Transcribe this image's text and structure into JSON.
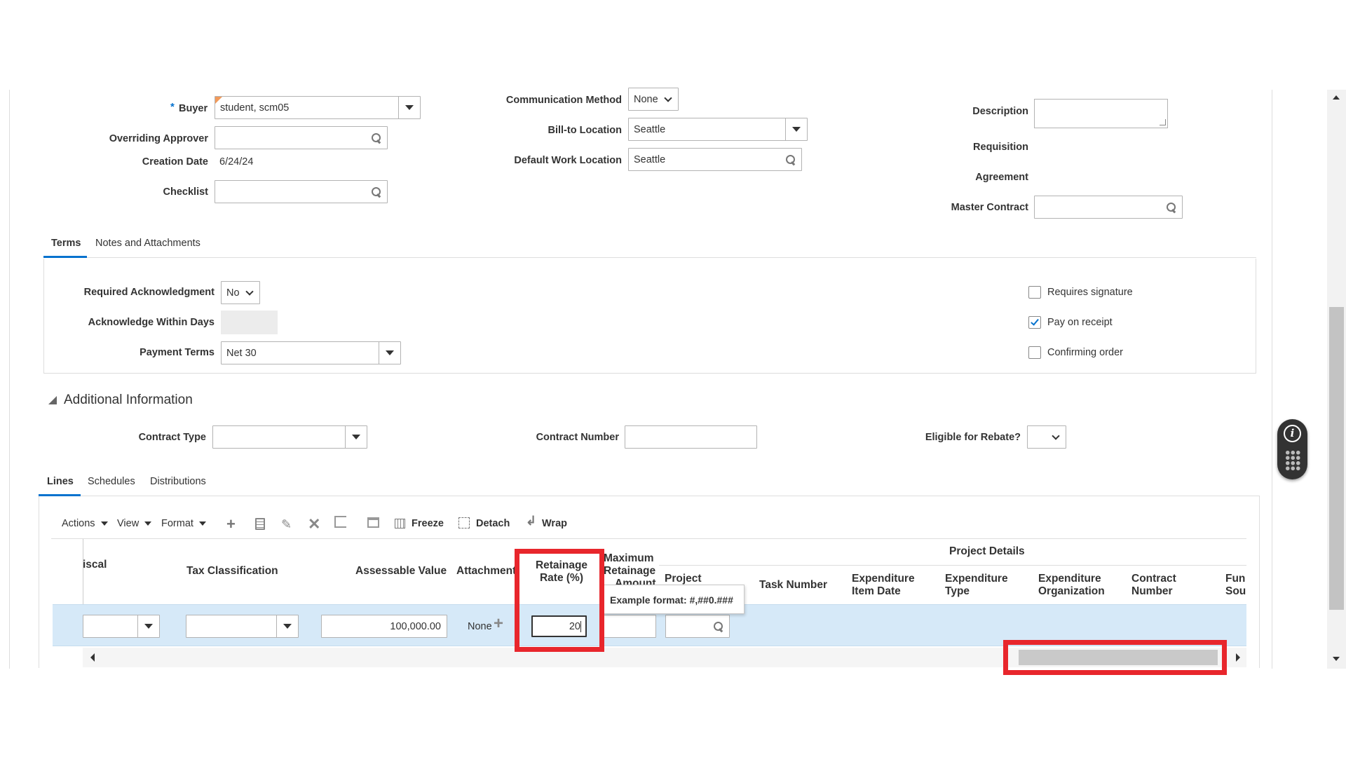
{
  "header": {
    "buyer_label": "Buyer",
    "buyer_value": "student, scm05",
    "overriding_approver_label": "Overriding Approver",
    "creation_date_label": "Creation Date",
    "creation_date_value": "6/24/24",
    "checklist_label": "Checklist",
    "communication_method_label": "Communication Method",
    "communication_method_value": "None",
    "bill_to_label": "Bill-to Location",
    "bill_to_value": "Seattle",
    "default_work_label": "Default Work Location",
    "default_work_value": "Seattle",
    "description_label": "Description",
    "requisition_label": "Requisition",
    "agreement_label": "Agreement",
    "master_contract_label": "Master Contract"
  },
  "terms_tabs": [
    "Terms",
    "Notes and Attachments"
  ],
  "terms": {
    "req_ack_label": "Required Acknowledgment",
    "req_ack_value": "No",
    "ack_days_label": "Acknowledge Within Days",
    "payment_terms_label": "Payment Terms",
    "payment_terms_value": "Net 30",
    "requires_signature": "Requires signature",
    "pay_on_receipt": "Pay on receipt",
    "confirming_order": "Confirming order"
  },
  "additional": {
    "title": "Additional Information",
    "contract_type_label": "Contract Type",
    "contract_number_label": "Contract Number",
    "rebate_label": "Eligible for Rebate?"
  },
  "lines_tabs": [
    "Lines",
    "Schedules",
    "Distributions"
  ],
  "toolbar": {
    "actions": "Actions",
    "view": "View",
    "format": "Format",
    "freeze": "Freeze",
    "detach": "Detach",
    "wrap": "Wrap"
  },
  "table": {
    "group_header": "Project Details",
    "col_fiscal": "iscal",
    "col_tax": "Tax Classification",
    "col_assessable": "Assessable Value",
    "col_attachments": "Attachment",
    "col_retainage_1": "Retainage",
    "col_retainage_2": "Rate (%)",
    "col_max_1": "Maximum",
    "col_max_2": "Retainage",
    "col_max_3": "Amount",
    "col_project": "Project",
    "col_task": "Task Number",
    "col_exp_date_1": "Expenditure",
    "col_exp_date_2": "Item Date",
    "col_exp_type_1": "Expenditure",
    "col_exp_type_2": "Type",
    "col_exp_org_1": "Expenditure",
    "col_exp_org_2": "Organization",
    "col_contract_1": "Contract",
    "col_contract_2": "Number",
    "col_fund_1": "Fun",
    "col_fund_2": "Sou",
    "row_assessable_value": "100,000.00",
    "row_attachments_value": "None",
    "row_retainage_value": "20",
    "tooltip": "Example format: #,##0.###"
  },
  "colors": {
    "highlight": "#e8262c",
    "row_selected": "#d6e9f8",
    "checkbox_checked": "#0572ce"
  }
}
